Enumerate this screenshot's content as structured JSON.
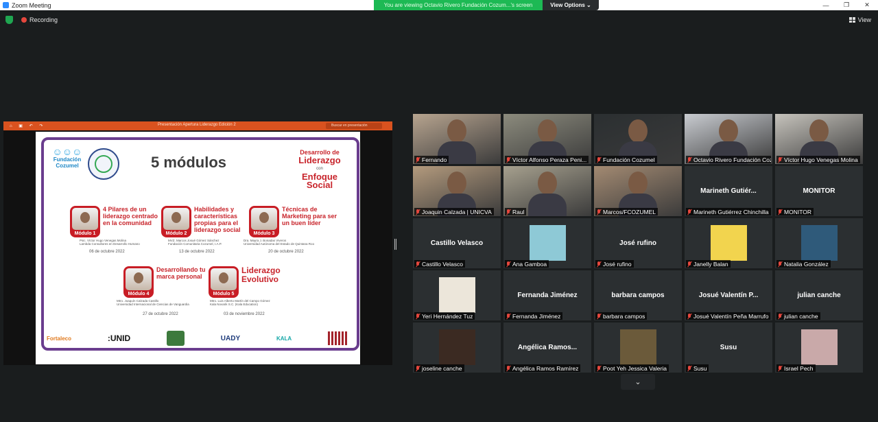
{
  "titlebar": {
    "app_title": "Zoom Meeting",
    "share_banner": "You are viewing Octavio Rivero Fundación Cozum...'s screen",
    "view_options": "View Options",
    "minimize": "—",
    "restore": "❐",
    "close": "✕"
  },
  "toolbar": {
    "recording_label": "Recording",
    "view_label": "View"
  },
  "presentation": {
    "title": "Presentación Apertura Liderazgo Edición 2",
    "search_placeholder": "Buscar en presentación",
    "toolbar_icons": "⌂ ▣ ↶ ↷",
    "slide": {
      "title": "5 módulos",
      "fundacion_logo": "Fundación Cozumel",
      "brand": {
        "line1": "Desarrollo de",
        "line2": "Liderazgo",
        "line3": "con",
        "line4": "Enfoque Social"
      },
      "modules": [
        {
          "label": "Módulo 1",
          "title": "4 Pilares de un liderazgo centrado en la comunidad",
          "presenter": "Psic. Víctor Hugo Venegas Molina",
          "org": "Lambda Consultores en Desarrollo Humano",
          "date": "06 de octubre 2022"
        },
        {
          "label": "Módulo 2",
          "title": "Habilidades y características propias para el liderazgo social",
          "presenter": "MVZ. Marcos Josué Gómez Sánchez",
          "org": "Fundación Comunitaria Cozumel, I.A.P.",
          "date": "13 de octubre 2022"
        },
        {
          "label": "Módulo 3",
          "title": "Técnicas de Marketing para ser un buen líder",
          "presenter": "Dra. Mayra J. Bonadas Viveros",
          "org": "Universidad Autónoma del Estado de Quintana Roo",
          "date": "20 de octubre 2022"
        },
        {
          "label": "Módulo 4",
          "title": "Desarrollando tu marca personal",
          "presenter": "Mtro. Joaquín Calzada Castillo",
          "org": "Universidad Internacional de Ciencias de Vanguardia",
          "date": "27 de octubre 2022"
        },
        {
          "label": "Módulo 5",
          "title": "Liderazgo Evolutivo",
          "presenter": "Mtro. Luis Alberto Martín del Campo Gómez",
          "org": "Kala Novarik S.C. (Kala Education)",
          "date": "03 de noviembre 2022"
        }
      ],
      "sponsors": [
        "Fortaleco",
        ":UNID",
        "",
        "UADY",
        "KALA",
        ""
      ]
    }
  },
  "participants": [
    {
      "name": "Fernando",
      "display": "",
      "video": true,
      "color": "#b7a48f"
    },
    {
      "name": "Víctor Alfonso Peraza Peni...",
      "display": "",
      "video": true,
      "color": "#8c8b7d"
    },
    {
      "name": "Fundación Cozumel",
      "display": "",
      "video": true,
      "color": "#2b2f31"
    },
    {
      "name": "Octavio Rivero Fundación Coz...",
      "display": "",
      "video": true,
      "color": "#c9ccd1",
      "active": true
    },
    {
      "name": "Víctor Hugo Venegas Molina",
      "display": "",
      "video": true,
      "color": "#c6c3bc"
    },
    {
      "name": "Joaquin Calzada | UNICVA",
      "display": "",
      "video": true,
      "color": "#b39a7d"
    },
    {
      "name": "Raul",
      "display": "",
      "video": true,
      "color": "#a6a08e"
    },
    {
      "name": "Marcos/FCOZUMEL",
      "display": "",
      "video": true,
      "color": "#a38a72"
    },
    {
      "name": "Marineth Gutiérrez Chinchilla",
      "display": "Marineth  Gutiér...",
      "video": false
    },
    {
      "name": "MONITOR",
      "display": "MONITOR",
      "video": false
    },
    {
      "name": "Castillo Velasco",
      "display": "Castillo Velasco",
      "video": false
    },
    {
      "name": "Ana Gamboa",
      "display": "",
      "video": false,
      "avatar": "#8ec9d6"
    },
    {
      "name": "José rufino",
      "display": "José rufino",
      "video": false
    },
    {
      "name": "Janelly Balan",
      "display": "",
      "video": false,
      "avatar": "#f2d44e"
    },
    {
      "name": "Natalia González",
      "display": "",
      "video": false,
      "avatar": "#2f5a7a"
    },
    {
      "name": "Yeri Hernández Tuz",
      "display": "",
      "video": false,
      "avatar": "#ece6da"
    },
    {
      "name": "Fernanda Jiménez",
      "display": "Fernanda Jiménez",
      "video": false
    },
    {
      "name": "barbara campos",
      "display": "barbara campos",
      "video": false
    },
    {
      "name": "Josué Valentín Peña Marrufo",
      "display": "Josué Valentín P...",
      "video": false
    },
    {
      "name": "julian canche",
      "display": "julian canche",
      "video": false
    },
    {
      "name": "joseline canche",
      "display": "",
      "video": false,
      "avatar": "#3b2a22"
    },
    {
      "name": "Angélica Ramos Ramírez",
      "display": "Angélica  Ramos...",
      "video": false
    },
    {
      "name": "Poot Yeh Jessica Valeria",
      "display": "",
      "video": false,
      "avatar": "#6b5a3a"
    },
    {
      "name": "Susu",
      "display": "Susu",
      "video": false
    },
    {
      "name": "Israel Pech",
      "display": "",
      "video": false,
      "avatar": "#c9a9a9"
    }
  ],
  "gallery": {
    "scroll_down": "⌄"
  }
}
